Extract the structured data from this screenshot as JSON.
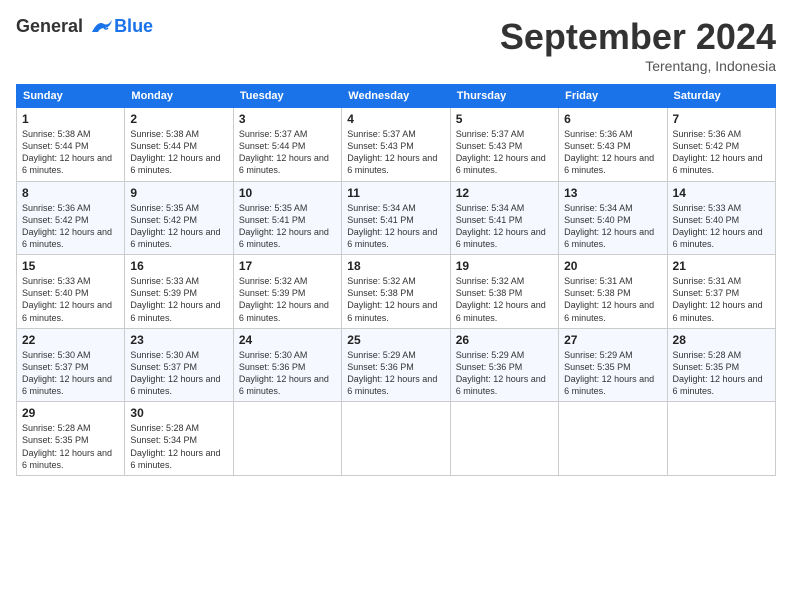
{
  "header": {
    "logo_line1": "General",
    "logo_line2": "Blue",
    "month": "September 2024",
    "location": "Terentang, Indonesia"
  },
  "days_of_week": [
    "Sunday",
    "Monday",
    "Tuesday",
    "Wednesday",
    "Thursday",
    "Friday",
    "Saturday"
  ],
  "weeks": [
    [
      {
        "day": "1",
        "sunrise": "5:38 AM",
        "sunset": "5:44 PM",
        "daylight": "12 hours and 6 minutes."
      },
      {
        "day": "2",
        "sunrise": "5:38 AM",
        "sunset": "5:44 PM",
        "daylight": "12 hours and 6 minutes."
      },
      {
        "day": "3",
        "sunrise": "5:37 AM",
        "sunset": "5:44 PM",
        "daylight": "12 hours and 6 minutes."
      },
      {
        "day": "4",
        "sunrise": "5:37 AM",
        "sunset": "5:43 PM",
        "daylight": "12 hours and 6 minutes."
      },
      {
        "day": "5",
        "sunrise": "5:37 AM",
        "sunset": "5:43 PM",
        "daylight": "12 hours and 6 minutes."
      },
      {
        "day": "6",
        "sunrise": "5:36 AM",
        "sunset": "5:43 PM",
        "daylight": "12 hours and 6 minutes."
      },
      {
        "day": "7",
        "sunrise": "5:36 AM",
        "sunset": "5:42 PM",
        "daylight": "12 hours and 6 minutes."
      }
    ],
    [
      {
        "day": "8",
        "sunrise": "5:36 AM",
        "sunset": "5:42 PM",
        "daylight": "12 hours and 6 minutes."
      },
      {
        "day": "9",
        "sunrise": "5:35 AM",
        "sunset": "5:42 PM",
        "daylight": "12 hours and 6 minutes."
      },
      {
        "day": "10",
        "sunrise": "5:35 AM",
        "sunset": "5:41 PM",
        "daylight": "12 hours and 6 minutes."
      },
      {
        "day": "11",
        "sunrise": "5:34 AM",
        "sunset": "5:41 PM",
        "daylight": "12 hours and 6 minutes."
      },
      {
        "day": "12",
        "sunrise": "5:34 AM",
        "sunset": "5:41 PM",
        "daylight": "12 hours and 6 minutes."
      },
      {
        "day": "13",
        "sunrise": "5:34 AM",
        "sunset": "5:40 PM",
        "daylight": "12 hours and 6 minutes."
      },
      {
        "day": "14",
        "sunrise": "5:33 AM",
        "sunset": "5:40 PM",
        "daylight": "12 hours and 6 minutes."
      }
    ],
    [
      {
        "day": "15",
        "sunrise": "5:33 AM",
        "sunset": "5:40 PM",
        "daylight": "12 hours and 6 minutes."
      },
      {
        "day": "16",
        "sunrise": "5:33 AM",
        "sunset": "5:39 PM",
        "daylight": "12 hours and 6 minutes."
      },
      {
        "day": "17",
        "sunrise": "5:32 AM",
        "sunset": "5:39 PM",
        "daylight": "12 hours and 6 minutes."
      },
      {
        "day": "18",
        "sunrise": "5:32 AM",
        "sunset": "5:38 PM",
        "daylight": "12 hours and 6 minutes."
      },
      {
        "day": "19",
        "sunrise": "5:32 AM",
        "sunset": "5:38 PM",
        "daylight": "12 hours and 6 minutes."
      },
      {
        "day": "20",
        "sunrise": "5:31 AM",
        "sunset": "5:38 PM",
        "daylight": "12 hours and 6 minutes."
      },
      {
        "day": "21",
        "sunrise": "5:31 AM",
        "sunset": "5:37 PM",
        "daylight": "12 hours and 6 minutes."
      }
    ],
    [
      {
        "day": "22",
        "sunrise": "5:30 AM",
        "sunset": "5:37 PM",
        "daylight": "12 hours and 6 minutes."
      },
      {
        "day": "23",
        "sunrise": "5:30 AM",
        "sunset": "5:37 PM",
        "daylight": "12 hours and 6 minutes."
      },
      {
        "day": "24",
        "sunrise": "5:30 AM",
        "sunset": "5:36 PM",
        "daylight": "12 hours and 6 minutes."
      },
      {
        "day": "25",
        "sunrise": "5:29 AM",
        "sunset": "5:36 PM",
        "daylight": "12 hours and 6 minutes."
      },
      {
        "day": "26",
        "sunrise": "5:29 AM",
        "sunset": "5:36 PM",
        "daylight": "12 hours and 6 minutes."
      },
      {
        "day": "27",
        "sunrise": "5:29 AM",
        "sunset": "5:35 PM",
        "daylight": "12 hours and 6 minutes."
      },
      {
        "day": "28",
        "sunrise": "5:28 AM",
        "sunset": "5:35 PM",
        "daylight": "12 hours and 6 minutes."
      }
    ],
    [
      {
        "day": "29",
        "sunrise": "5:28 AM",
        "sunset": "5:35 PM",
        "daylight": "12 hours and 6 minutes."
      },
      {
        "day": "30",
        "sunrise": "5:28 AM",
        "sunset": "5:34 PM",
        "daylight": "12 hours and 6 minutes."
      },
      null,
      null,
      null,
      null,
      null
    ]
  ],
  "labels": {
    "sunrise": "Sunrise:",
    "sunset": "Sunset:",
    "daylight": "Daylight:"
  }
}
